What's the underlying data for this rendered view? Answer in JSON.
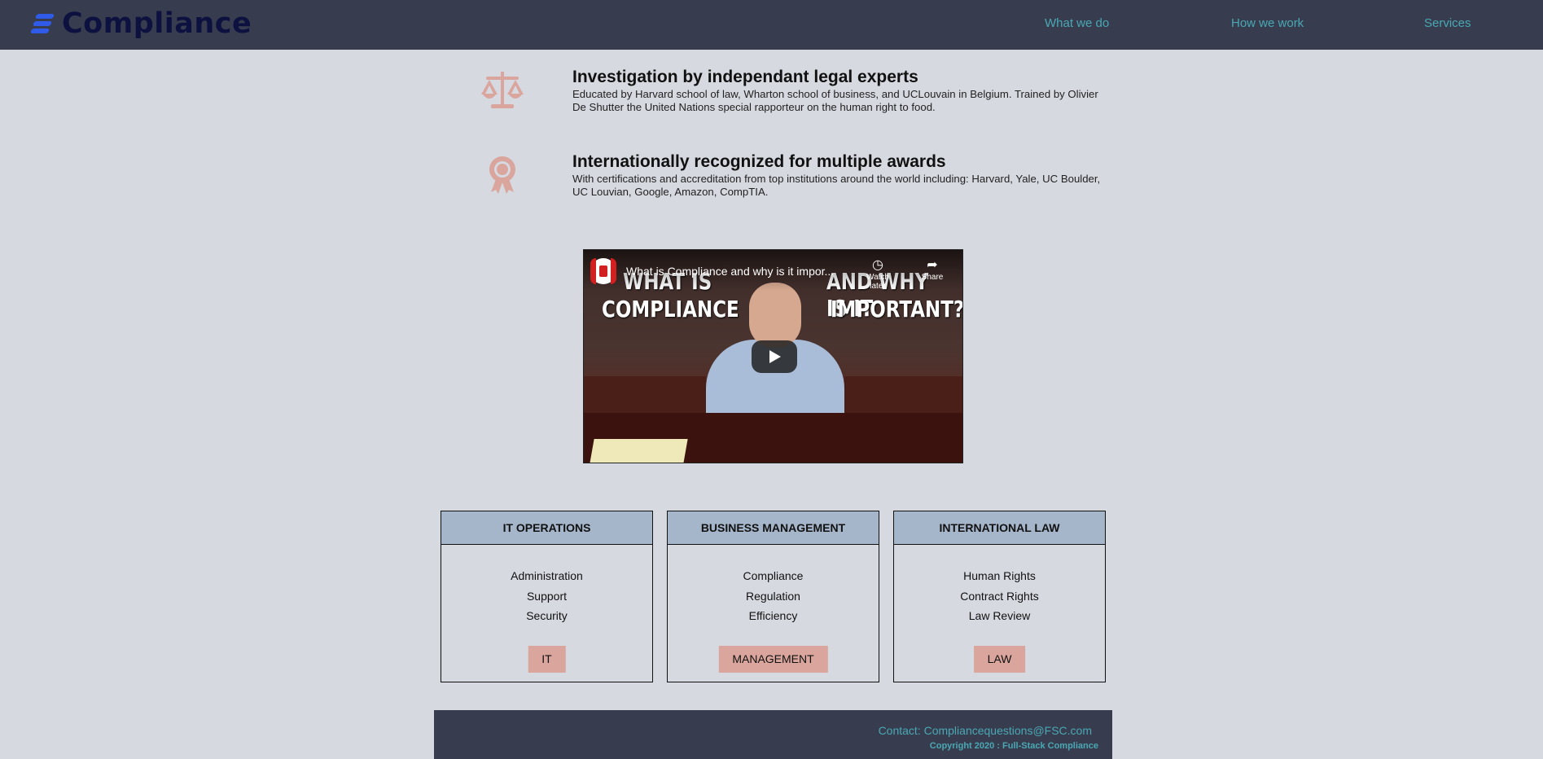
{
  "header": {
    "brand": "Compliance",
    "nav": [
      "What we do",
      "How we work",
      "Services"
    ]
  },
  "features": [
    {
      "icon": "scales-icon",
      "title": "Investigation by independant legal experts",
      "text": "Educated by Harvard school of law, Wharton school of business, and UCLouvain in Belgium. Trained by Olivier De Shutter the United Nations special rapporteur on the human right to food."
    },
    {
      "icon": "award-ribbon-icon",
      "title": "Internationally recognized for multiple awards",
      "text": "With certifications and accreditation from top institutions around the world including: Harvard, Yale, UC Boulder, UC Louvian, Google, Amazon, CompTIA."
    }
  ],
  "video": {
    "title": "What is Compliance and why is it impor...",
    "watch_later": "Watch later",
    "share": "Share",
    "overlay_left": [
      "WHAT IS",
      "COMPLIANCE"
    ],
    "overlay_right": [
      "AND WHY IS IT",
      "IMPORTANT?"
    ]
  },
  "cards": [
    {
      "title": "IT OPERATIONS",
      "items": [
        "Administration",
        "Support",
        "Security"
      ],
      "button": "IT"
    },
    {
      "title": "BUSINESS MANAGEMENT",
      "items": [
        "Compliance",
        "Regulation",
        "Efficiency"
      ],
      "button": "MANAGEMENT"
    },
    {
      "title": "INTERNATIONAL LAW",
      "items": [
        "Human Rights",
        "Contract Rights",
        "Law Review"
      ],
      "button": "LAW"
    }
  ],
  "footer": {
    "contact": "Contact: Compliancequestions@FSC.com",
    "copyright": "Copyright 2020 : Full-Stack Compliance"
  },
  "colors": {
    "header_bg": "#373d4f",
    "page_bg": "#d6d9e0",
    "link": "#4aa8b4",
    "icon_accent": "#d9a59c",
    "card_head": "#a5b6cb",
    "logo_blue": "#2f5be8"
  }
}
